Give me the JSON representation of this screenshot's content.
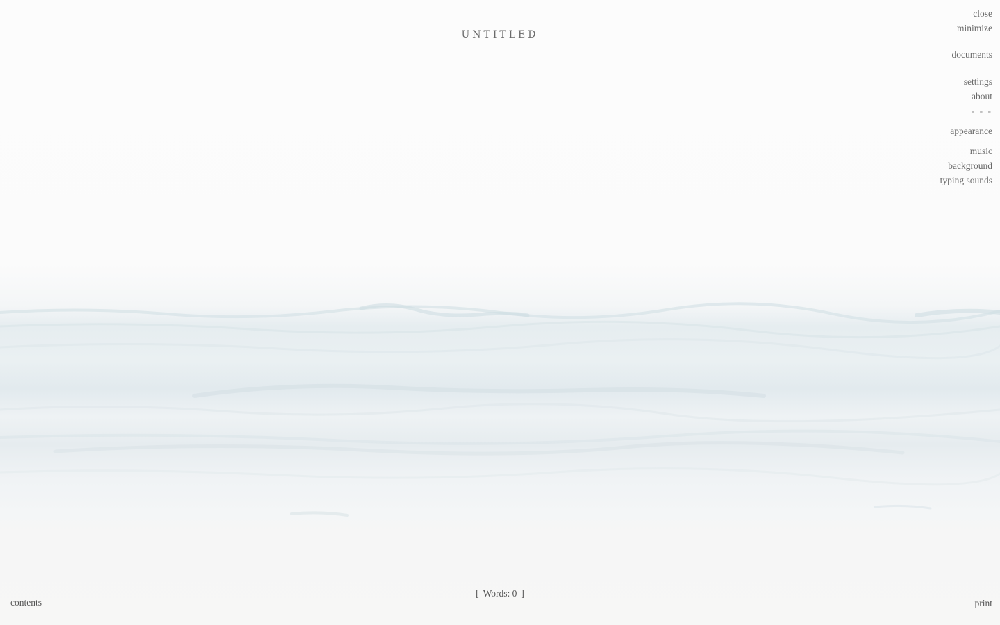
{
  "document": {
    "title": "UNTITLED",
    "content": ""
  },
  "menu": {
    "close": "close",
    "minimize": "minimize",
    "documents": "documents",
    "settings": "settings",
    "about": "about",
    "separator": "- - -",
    "appearance": "appearance",
    "music": "music",
    "background": "background",
    "typing_sounds": "typing sounds"
  },
  "footer": {
    "contents": "contents",
    "print": "print",
    "word_count_open": "[",
    "word_count_label": "Words: 0",
    "word_count_close": "]"
  },
  "icons": {
    "caret": "text-caret-icon"
  }
}
